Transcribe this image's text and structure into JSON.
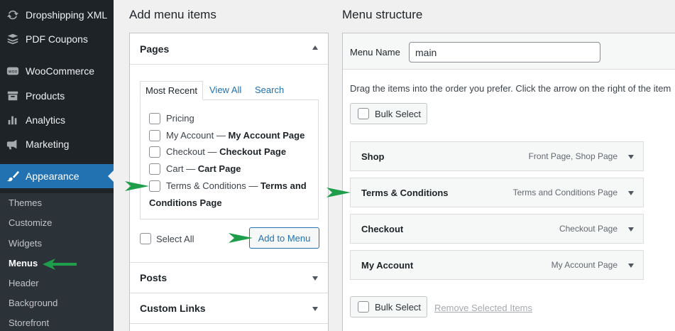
{
  "sidebar": {
    "menu": [
      {
        "label": "Dropshipping XML",
        "icon": "sync-icon"
      },
      {
        "label": "PDF Coupons",
        "icon": "stack-icon"
      },
      {
        "label": "WooCommerce",
        "icon": "woo-icon"
      },
      {
        "label": "Products",
        "icon": "archive-icon"
      },
      {
        "label": "Analytics",
        "icon": "bar-chart-icon"
      },
      {
        "label": "Marketing",
        "icon": "megaphone-icon"
      },
      {
        "label": "Appearance",
        "icon": "paintbrush-icon"
      }
    ],
    "submenu": [
      "Themes",
      "Customize",
      "Widgets",
      "Menus",
      "Header",
      "Background",
      "Storefront"
    ]
  },
  "add_items": {
    "heading": "Add menu items",
    "pages_heading": "Pages",
    "tabs": [
      "Most Recent",
      "View All",
      "Search"
    ],
    "pages": [
      {
        "title": "Pricing",
        "suffix": ""
      },
      {
        "title": "My Account",
        "suffix": "My Account Page"
      },
      {
        "title": "Checkout",
        "suffix": "Checkout Page"
      },
      {
        "title": "Cart",
        "suffix": "Cart Page"
      },
      {
        "title": "Terms & Conditions",
        "suffix": "Terms and",
        "suffix2": "Conditions Page"
      }
    ],
    "select_all": "Select All",
    "add_button": "Add to Menu",
    "posts_heading": "Posts",
    "custom_links_heading": "Custom Links"
  },
  "structure": {
    "heading": "Menu structure",
    "menu_name_label": "Menu Name",
    "menu_name_value": "main",
    "instructions": "Drag the items into the order you prefer. Click the arrow on the right of the item",
    "bulk_select": "Bulk Select",
    "items": [
      {
        "title": "Shop",
        "type": "Front Page, Shop Page"
      },
      {
        "title": "Terms & Conditions",
        "type": "Terms and Conditions Page"
      },
      {
        "title": "Checkout",
        "type": "Checkout Page"
      },
      {
        "title": "My Account",
        "type": "My Account Page"
      }
    ],
    "remove_selected": "Remove Selected Items"
  },
  "colors": {
    "sidebar_bg": "#1d2327",
    "accent": "#2271b1",
    "arrow": "#1e9e4a"
  }
}
